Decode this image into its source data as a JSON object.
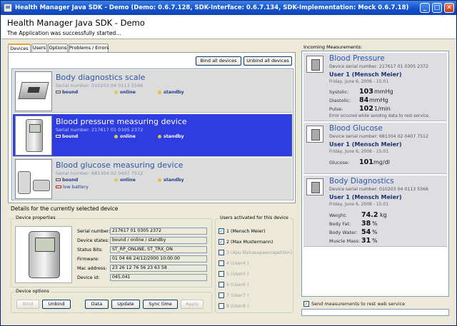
{
  "window": {
    "title": "Health Manager Java SDK - Demo (Demo: 0.6.7.128, SDK-Interface: 0.6.7.134, SDK-Implementation: Mock 0.6.7.18)",
    "minimize": "_",
    "maximize": "□",
    "close": "✕"
  },
  "header": {
    "title": "Health Manager Java SDK - Demo",
    "status": "The Application was successfully started..."
  },
  "tabs": [
    "Devices",
    "Users",
    "Options",
    "Problems / Errors"
  ],
  "devices_toolbar": {
    "bind_all": "Bind all devices",
    "unbind_all": "Unbind all devices"
  },
  "devices": [
    {
      "name": "Body diagnostics scale",
      "serial": "Serial number: 010203 04 0113 5566",
      "bound": "bound",
      "online": "online",
      "standby": "standby",
      "low_battery": "",
      "icon": "scale-icon"
    },
    {
      "name": "Blood pressure measuring device",
      "serial": "Serial number: 217617 01 0305 2372",
      "bound": "bound",
      "online": "online",
      "standby": "standby",
      "low_battery": "",
      "icon": "blood-pressure-monitor-icon"
    },
    {
      "name": "Blood glucose measuring device",
      "serial": "Serial number: 681304 02 0407 7512",
      "bound": "bound",
      "online": "online",
      "standby": "standby",
      "low_battery": "low battery",
      "icon": "glucose-meter-icon"
    }
  ],
  "details": {
    "title": "Details for the currently selected device",
    "properties_label": "Device properties",
    "properties": [
      {
        "label": "Serial number:",
        "value": "217617 01 0305 2372"
      },
      {
        "label": "Device states:",
        "value": "bound / online / standby"
      },
      {
        "label": "Status Bits:",
        "value": "ST_RP_ONLINE, ST_TRX_ON"
      },
      {
        "label": "Firmware:",
        "value": "01 04 66 24/12/2000 10:00:00"
      },
      {
        "label": "Mac address:",
        "value": "23 26 12 76 56 23 63 58"
      },
      {
        "label": "Device id:",
        "value": "045.041"
      }
    ],
    "options_label": "Device options",
    "buttons": {
      "bind": "Bind",
      "unbind": "Unbind",
      "data": "Data",
      "update": "Update",
      "sync_time": "Sync time",
      "apply": "Apply"
    },
    "users_label": "Users activated for this device",
    "users": [
      {
        "label": "1 (Mensch Meier)",
        "checked": true
      },
      {
        "label": "2 (Max Mustermann)",
        "checked": true
      },
      {
        "label": "3 (Apu Nahasapeemapetilon)",
        "checked": false
      },
      {
        "label": "4 (User4 )",
        "checked": false
      },
      {
        "label": "5 (User5 )",
        "checked": false
      },
      {
        "label": "6 (User6 )",
        "checked": false
      },
      {
        "label": "7 (User7 )",
        "checked": false
      },
      {
        "label": "8 (User8 )",
        "checked": false
      }
    ]
  },
  "measurements": {
    "title": "Incoming Measurements:",
    "items": [
      {
        "name": "Blood Pressure",
        "serial": "Device serial number: 217617 01 0305 2372",
        "user": "User 1 (Mensch Meier)",
        "date": "Friday, June 6, 2008 - 15:01",
        "rows": [
          {
            "label": "Systolic:",
            "value": "103",
            "unit": "mmHg"
          },
          {
            "label": "Diastolic:",
            "value": "84",
            "unit": "mmHg"
          },
          {
            "label": "Pulse:",
            "value": "102",
            "unit": "1/min"
          }
        ],
        "error": "Error occured while sending data to rest service."
      },
      {
        "name": "Blood Glucose",
        "serial": "Device serial number: 681304 02 0407 7512",
        "user": "User 1 (Mensch Meier)",
        "date": "Friday, June 6, 2008 - 15:01",
        "rows": [
          {
            "label": "Glucose:",
            "value": "101",
            "unit": "mg/dl"
          }
        ],
        "error": ""
      },
      {
        "name": "Body Diagnostics",
        "serial": "Device serial number: 010203 04 0113 5566",
        "user": "User 1 (Mensch Meier)",
        "date": "Friday, June 6, 2008 - 15:01",
        "rows": [
          {
            "label": "Weight:",
            "value": "74.2",
            "unit": "kg"
          },
          {
            "label": "Body Fat:",
            "value": "38",
            "unit": "%"
          },
          {
            "label": "Body Water:",
            "value": "54",
            "unit": "%"
          },
          {
            "label": "Muscle Mass:",
            "value": "31",
            "unit": "%"
          }
        ],
        "error": ""
      }
    ],
    "send_label": "Send measurements to rest web service",
    "send_checked": true
  },
  "colors": {
    "selected_row": "#2f3de0",
    "device_name": "#2b57a8",
    "titlebar": "#1452cc"
  }
}
